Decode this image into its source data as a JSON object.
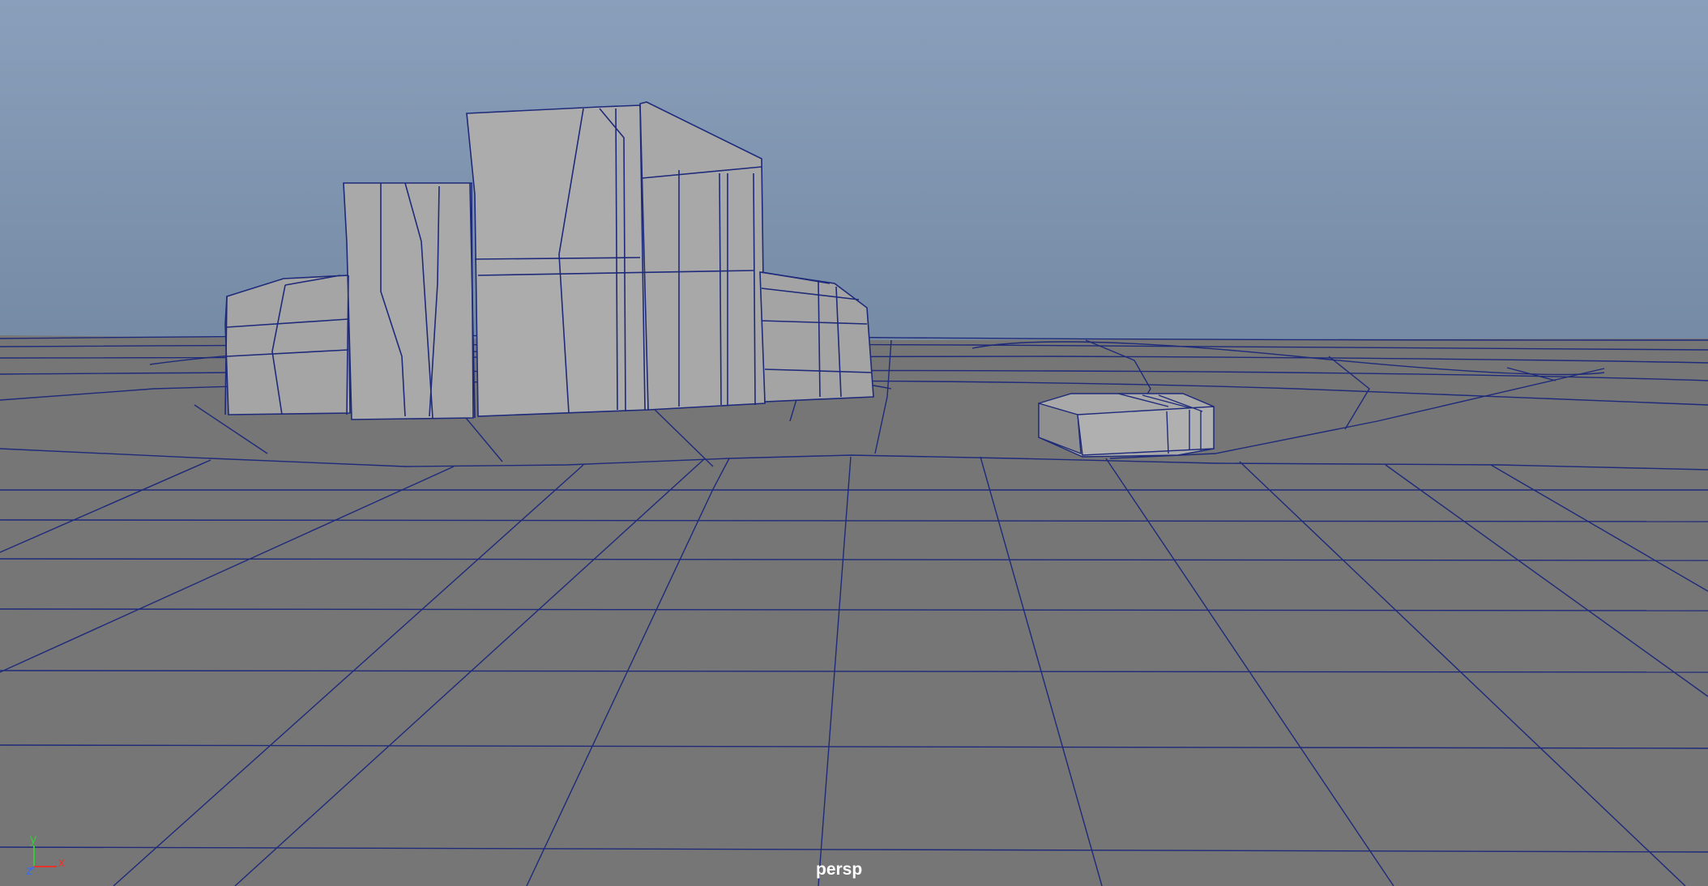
{
  "viewport": {
    "camera_label": "persp",
    "background_top": "#8a9fbb",
    "background_bottom": "#566375",
    "ground_color": "#767676",
    "wire_color": "#1e2a7a",
    "mesh_face_color": "#a9a9a9"
  },
  "objects": [
    {
      "name": "rock-cliff-mesh",
      "type": "polygon-mesh"
    },
    {
      "name": "flat-stone-mesh",
      "type": "polygon-mesh"
    },
    {
      "name": "ground-plane-mesh",
      "type": "polygon-mesh"
    }
  ],
  "axis_gizmo": {
    "x_label": "x",
    "y_label": "y",
    "z_label": "z",
    "x_color": "#e8332a",
    "y_color": "#3ec43e",
    "z_color": "#3a6cf0"
  }
}
